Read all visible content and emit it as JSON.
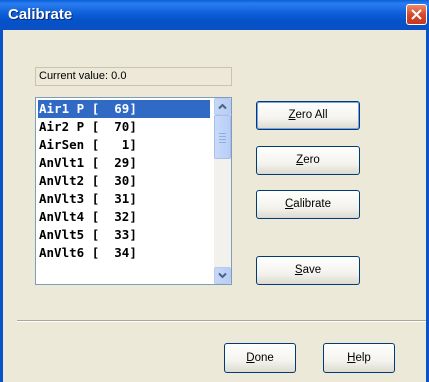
{
  "window": {
    "title": "Calibrate"
  },
  "current_value": {
    "text": "Current value:  0.0"
  },
  "channel_list": {
    "items": [
      {
        "name": "Air1 P",
        "value": "[  69]",
        "selected": true
      },
      {
        "name": "Air2 P",
        "value": "[  70]",
        "selected": false
      },
      {
        "name": "AirSen",
        "value": "[   1]",
        "selected": false
      },
      {
        "name": "AnVlt1",
        "value": "[  29]",
        "selected": false
      },
      {
        "name": "AnVlt2",
        "value": "[  30]",
        "selected": false
      },
      {
        "name": "AnVlt3",
        "value": "[  31]",
        "selected": false
      },
      {
        "name": "AnVlt4",
        "value": "[  32]",
        "selected": false
      },
      {
        "name": "AnVlt5",
        "value": "[  33]",
        "selected": false
      },
      {
        "name": "AnVlt6",
        "value": "[  34]",
        "selected": false
      }
    ]
  },
  "buttons": {
    "zero_all": {
      "mnemonic": "Z",
      "rest": "ero All"
    },
    "zero": {
      "mnemonic": "Z",
      "rest": "ero"
    },
    "calibrate": {
      "mnemonic": "C",
      "rest": "alibrate"
    },
    "save": {
      "mnemonic": "S",
      "rest": "ave"
    },
    "done": {
      "mnemonic": "D",
      "rest": "one"
    },
    "help": {
      "mnemonic": "H",
      "rest": "elp"
    }
  },
  "colors": {
    "title_bar": "#0a5fd8",
    "selection": "#316ac5",
    "close_button": "#d5462a"
  }
}
